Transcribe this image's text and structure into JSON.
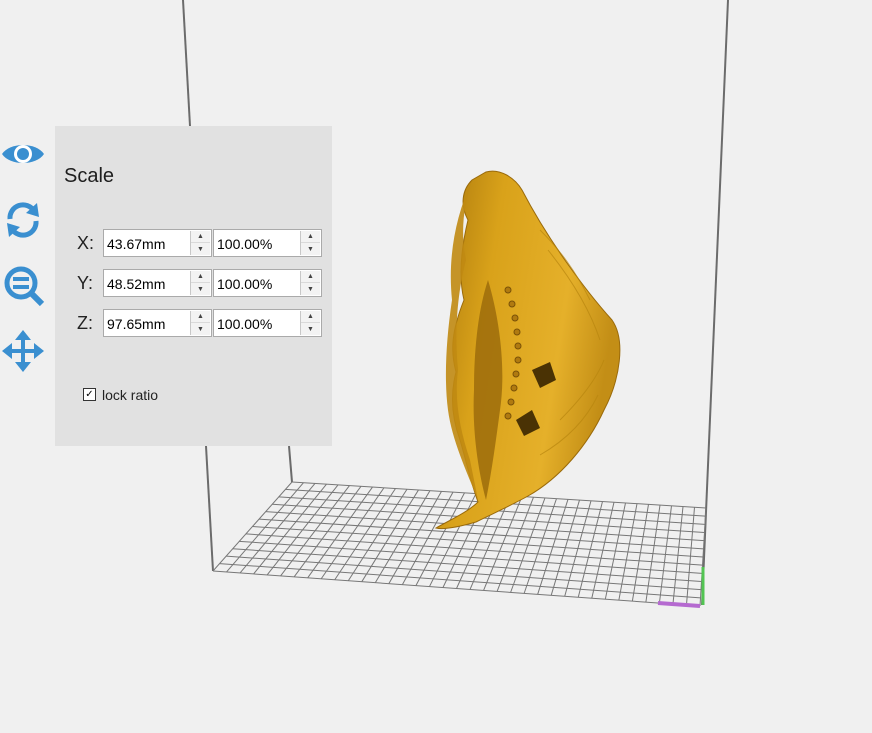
{
  "toolbar": {
    "items": [
      {
        "name": "view",
        "icon": "eye-icon"
      },
      {
        "name": "rotate",
        "icon": "rotate-icon"
      },
      {
        "name": "scale",
        "icon": "scale-zoom-icon"
      },
      {
        "name": "move",
        "icon": "move-icon"
      }
    ],
    "accent": "#3a8fd0"
  },
  "scale_panel": {
    "title": "Scale",
    "rows": [
      {
        "axis": "X:",
        "size": "43.67mm",
        "percent": "100.00%"
      },
      {
        "axis": "Y:",
        "size": "48.52mm",
        "percent": "100.00%"
      },
      {
        "axis": "Z:",
        "size": "97.65mm",
        "percent": "100.00%"
      }
    ],
    "lock_ratio": {
      "label": "lock ratio",
      "checked": true
    }
  },
  "viewport": {
    "model_color": "#d9a21a",
    "grid_color": "#6a6a6a",
    "axis_x_color": "#b56ad0",
    "axis_y_color": "#52c452"
  }
}
